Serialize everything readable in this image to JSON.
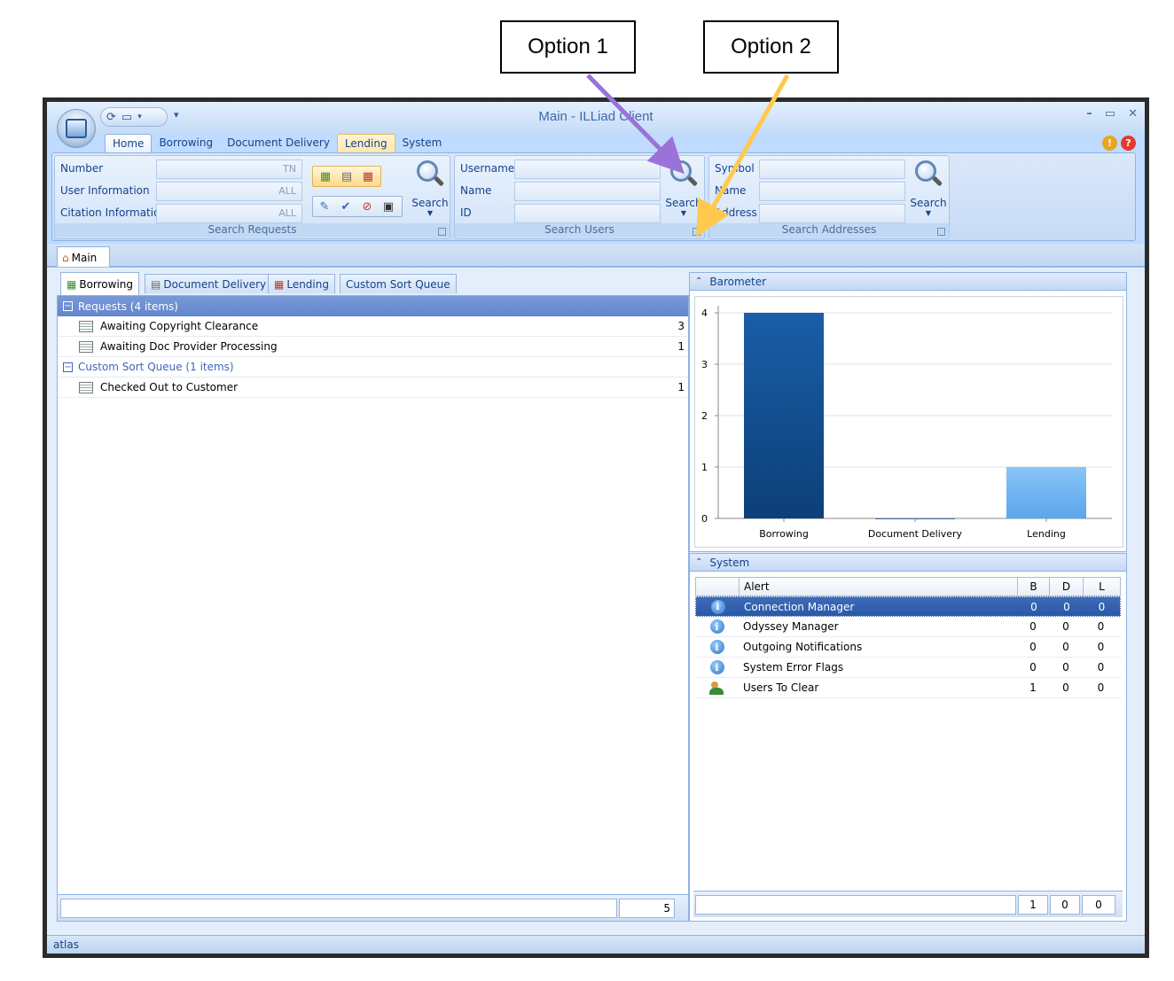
{
  "callouts": {
    "option1": "Option 1",
    "option2": "Option 2"
  },
  "colors": {
    "arrow1": "#9b72d8",
    "arrow2": "#ffc94d",
    "bar_borrowing": "#1a5ea7",
    "bar_lending": "#5aa6ec"
  },
  "window": {
    "title": "Main - ILLiad Client",
    "ribbon_tabs": [
      "Home",
      "Borrowing",
      "Document Delivery",
      "Lending",
      "System"
    ]
  },
  "search_requests": {
    "labels": [
      "Number",
      "User Information",
      "Citation Information"
    ],
    "values": [
      "TN",
      "ALL",
      "ALL"
    ],
    "search_label": "Search",
    "group_label": "Search Requests"
  },
  "search_users": {
    "labels": [
      "Username",
      "Name",
      "ID"
    ],
    "search_label": "Search",
    "group_label": "Search Users"
  },
  "search_addresses": {
    "labels": [
      "Symbol",
      "Name",
      "Address"
    ],
    "search_label": "Search",
    "group_label": "Search Addresses"
  },
  "doc_tab": {
    "label": "Main"
  },
  "queue_tabs": [
    "Borrowing",
    "Document Delivery",
    "Lending",
    "Custom Sort Queue"
  ],
  "queue_list": {
    "groups": [
      {
        "label": "Requests  (4 items)",
        "items": [
          {
            "label": "Awaiting Copyright Clearance",
            "count": "3"
          },
          {
            "label": "Awaiting Doc Provider Processing",
            "count": "1"
          }
        ]
      },
      {
        "label": "Custom Sort Queue  (1 items)",
        "items": [
          {
            "label": "Checked Out to Customer",
            "count": "1"
          }
        ]
      }
    ],
    "total": "5"
  },
  "barometer": {
    "header": "Barometer"
  },
  "chart_data": {
    "type": "bar",
    "categories": [
      "Borrowing",
      "Document Delivery",
      "Lending"
    ],
    "values": [
      4,
      0,
      1
    ],
    "ylim": [
      0,
      4
    ],
    "yticks": [
      0,
      1,
      2,
      3,
      4
    ],
    "grid": true
  },
  "system": {
    "header": "System",
    "columns": [
      "Alert",
      "B",
      "D",
      "L"
    ],
    "rows": [
      {
        "icon": "info-icon",
        "alert": "Connection Manager",
        "b": "0",
        "d": "0",
        "l": "0"
      },
      {
        "icon": "info-icon",
        "alert": "Odyssey Manager",
        "b": "0",
        "d": "0",
        "l": "0"
      },
      {
        "icon": "info-icon",
        "alert": "Outgoing Notifications",
        "b": "0",
        "d": "0",
        "l": "0"
      },
      {
        "icon": "info-icon",
        "alert": "System Error Flags",
        "b": "0",
        "d": "0",
        "l": "0"
      },
      {
        "icon": "users-icon",
        "alert": "Users To Clear",
        "b": "1",
        "d": "0",
        "l": "0"
      }
    ],
    "totals": {
      "b": "1",
      "d": "0",
      "l": "0"
    }
  },
  "statusbar": {
    "text": "atlas"
  }
}
